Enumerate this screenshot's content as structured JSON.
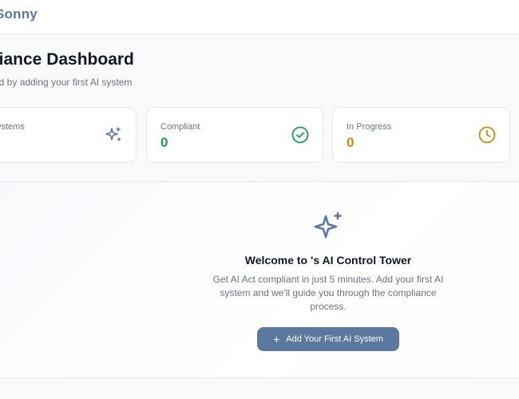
{
  "header": {
    "brand": "Sonny"
  },
  "page": {
    "title": "pliance Dashboard",
    "subtitle": "ed by adding your first AI system"
  },
  "stats": [
    {
      "label": "ystems",
      "value": "",
      "icon": "sparkles-icon",
      "color": "#5b789f"
    },
    {
      "label": "Compliant",
      "value": "0",
      "icon": "check-circle-icon",
      "color": "#16a34a"
    },
    {
      "label": "In Progress",
      "value": "0",
      "icon": "clock-icon",
      "color": "#ca8a04"
    }
  ],
  "welcome": {
    "icon": "sparkles-icon",
    "title": "Welcome to 's AI Control Tower",
    "body": "Get AI Act compliant in just 5 minutes. Add your first AI system and we'll guide you through the compliance process.",
    "cta_label": "Add Your First AI System",
    "cta_icon": "plus-icon"
  },
  "colors": {
    "accent": "#5b789f",
    "success": "#16a34a",
    "warning": "#ca8a04"
  }
}
